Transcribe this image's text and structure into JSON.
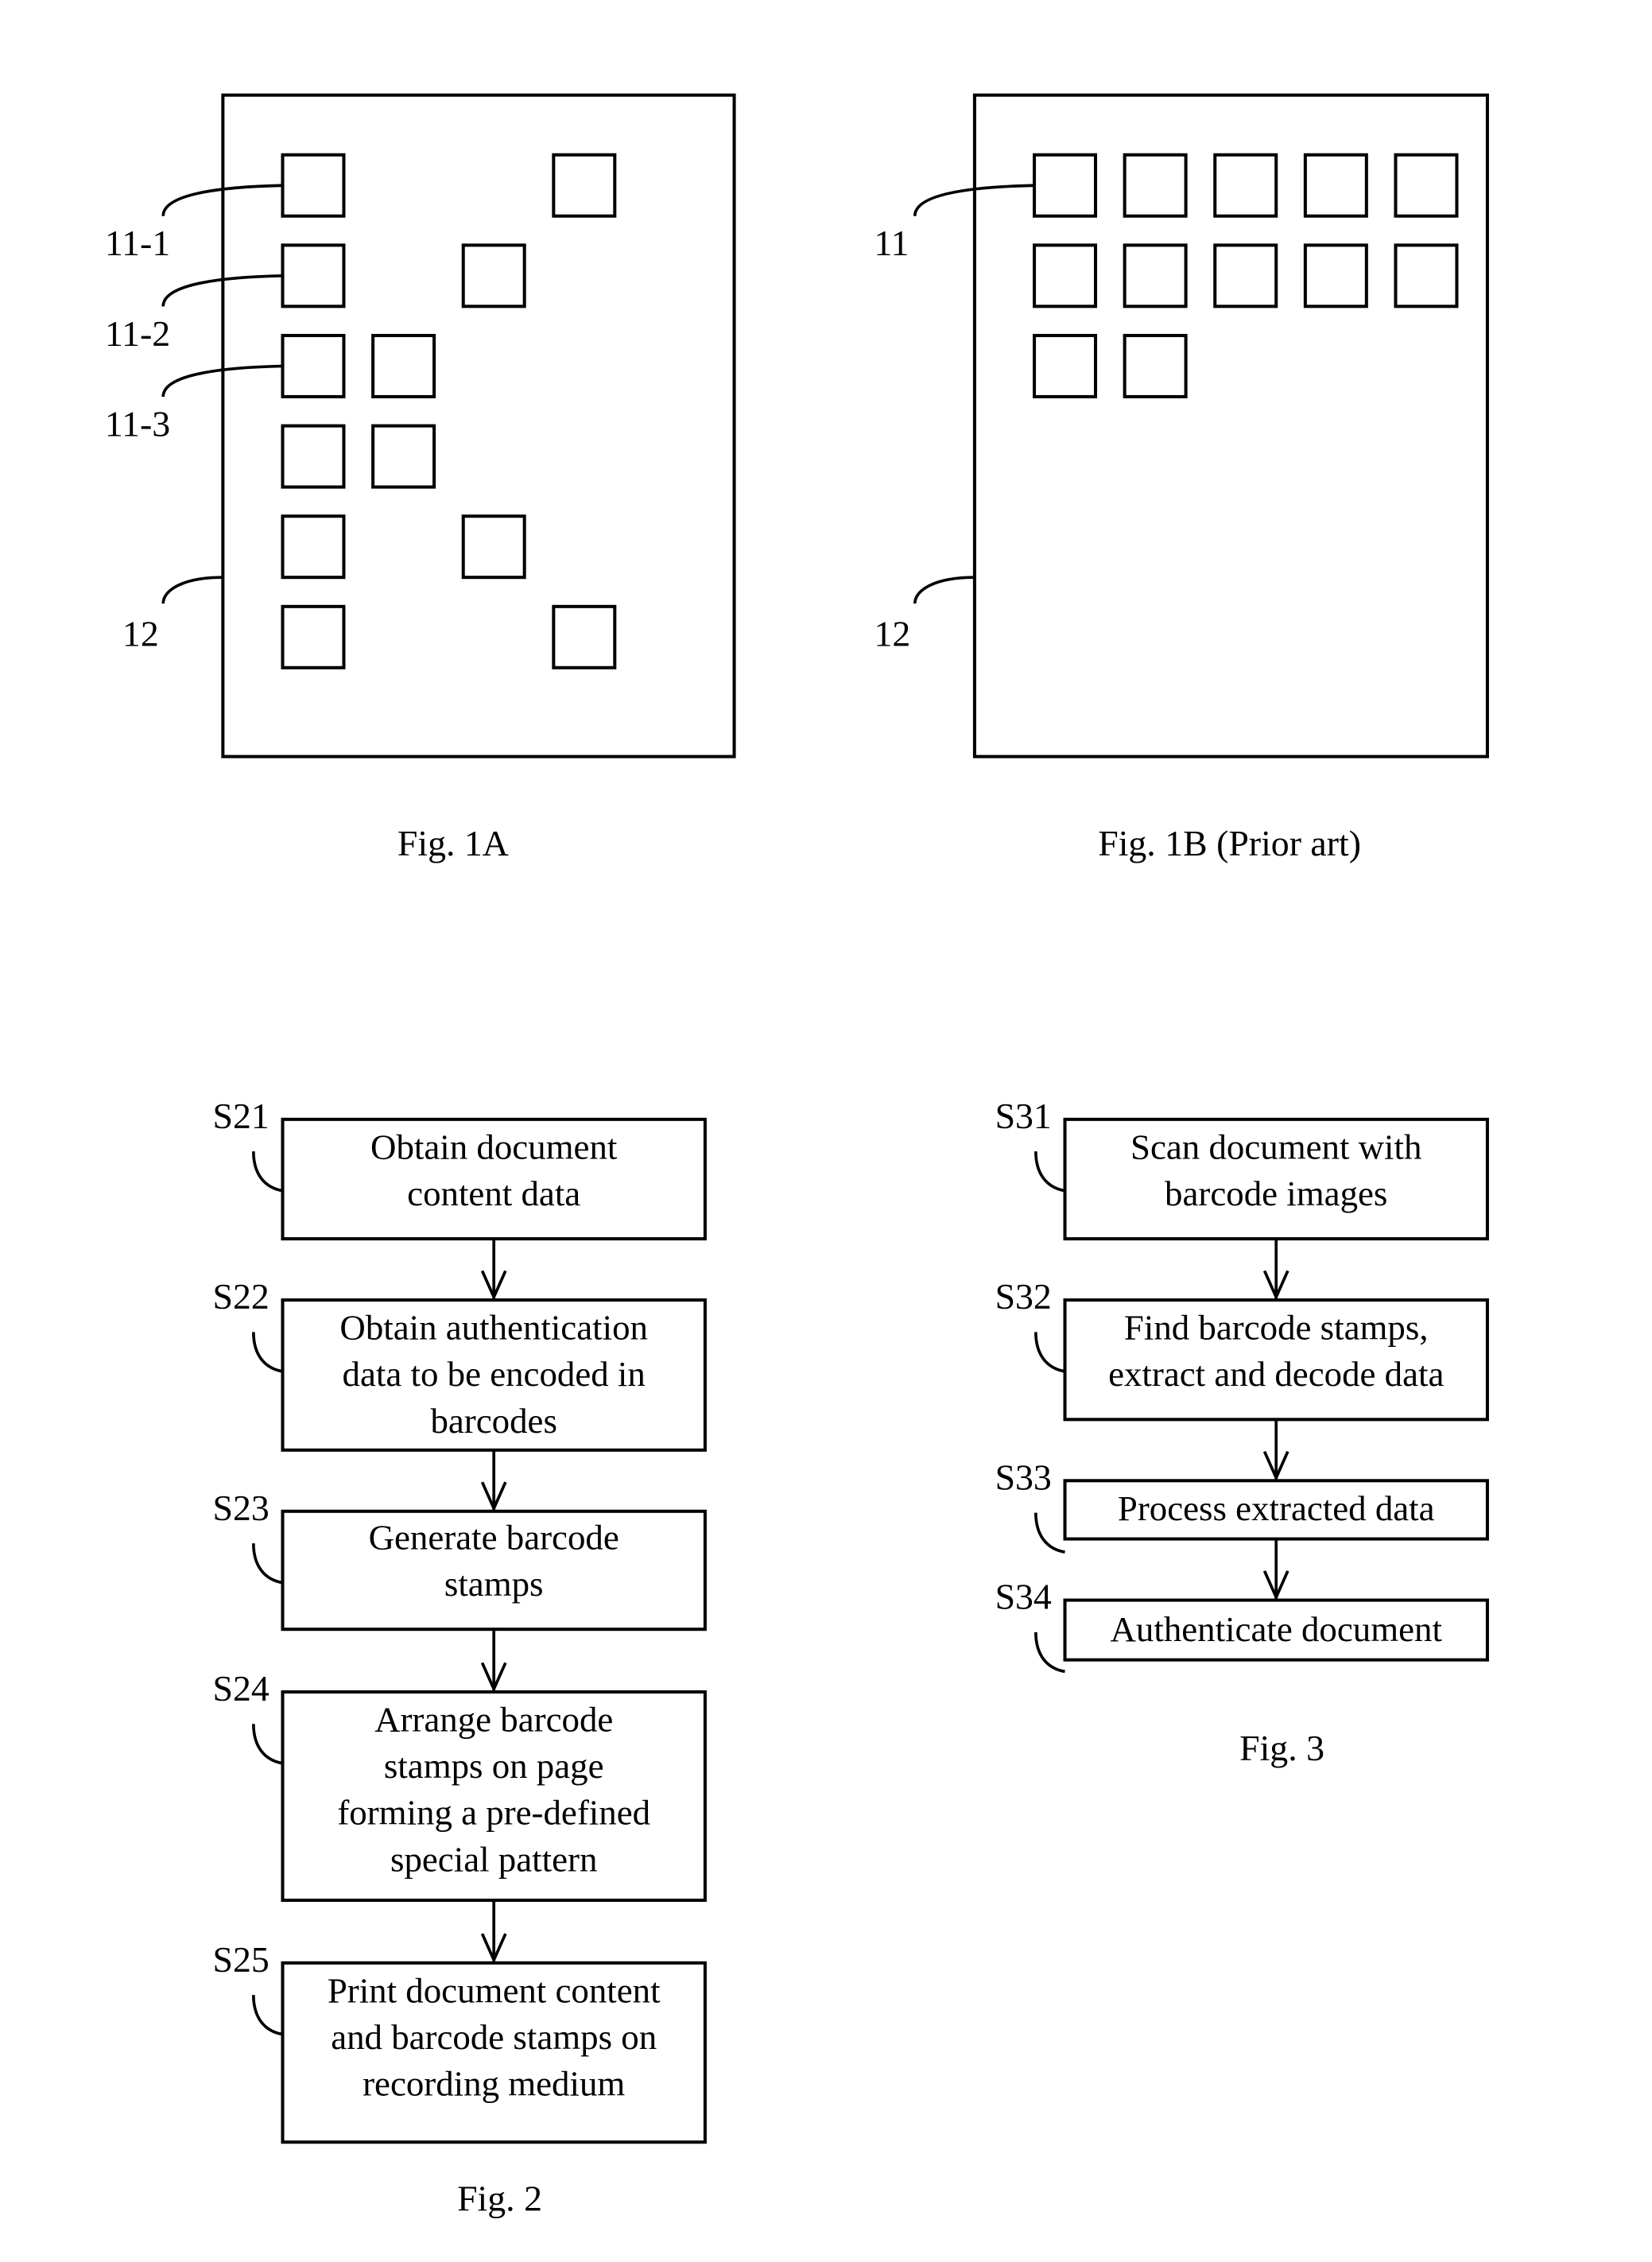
{
  "fig1a": {
    "caption": "Fig. 1A",
    "labels": {
      "stamp_1": "11-1",
      "stamp_2": "11-2",
      "stamp_3": "11-3",
      "page": "12"
    },
    "stamp_grid": {
      "columns": 4,
      "rows": 6,
      "occupied_cells": [
        [
          0,
          0
        ],
        [
          0,
          3
        ],
        [
          1,
          0
        ],
        [
          1,
          2
        ],
        [
          2,
          0
        ],
        [
          2,
          1
        ],
        [
          3,
          0
        ],
        [
          3,
          1
        ],
        [
          4,
          0
        ],
        [
          4,
          2
        ],
        [
          5,
          0
        ],
        [
          5,
          3
        ]
      ]
    }
  },
  "fig1b": {
    "caption": "Fig. 1B (Prior art)",
    "labels": {
      "stamp": "11",
      "page": "12"
    },
    "stamp_grid": {
      "columns": 5,
      "rows": 3,
      "stamp_count": 12
    }
  },
  "fig2": {
    "caption": "Fig. 2",
    "steps": [
      {
        "id": "S21",
        "lines": [
          "Obtain document",
          "content data"
        ]
      },
      {
        "id": "S22",
        "lines": [
          "Obtain authentication",
          "data to be encoded in",
          "barcodes"
        ]
      },
      {
        "id": "S23",
        "lines": [
          "Generate barcode",
          "stamps"
        ]
      },
      {
        "id": "S24",
        "lines": [
          "Arrange barcode",
          "stamps on page",
          "forming a pre-defined",
          "special pattern"
        ]
      },
      {
        "id": "S25",
        "lines": [
          "Print document content",
          "and barcode stamps on",
          "recording medium"
        ]
      }
    ]
  },
  "fig3": {
    "caption": "Fig. 3",
    "steps": [
      {
        "id": "S31",
        "lines": [
          "Scan document with",
          "barcode images"
        ]
      },
      {
        "id": "S32",
        "lines": [
          "Find barcode stamps,",
          "extract and decode data"
        ]
      },
      {
        "id": "S33",
        "lines": [
          "Process extracted data"
        ]
      },
      {
        "id": "S34",
        "lines": [
          "Authenticate document"
        ]
      }
    ]
  }
}
